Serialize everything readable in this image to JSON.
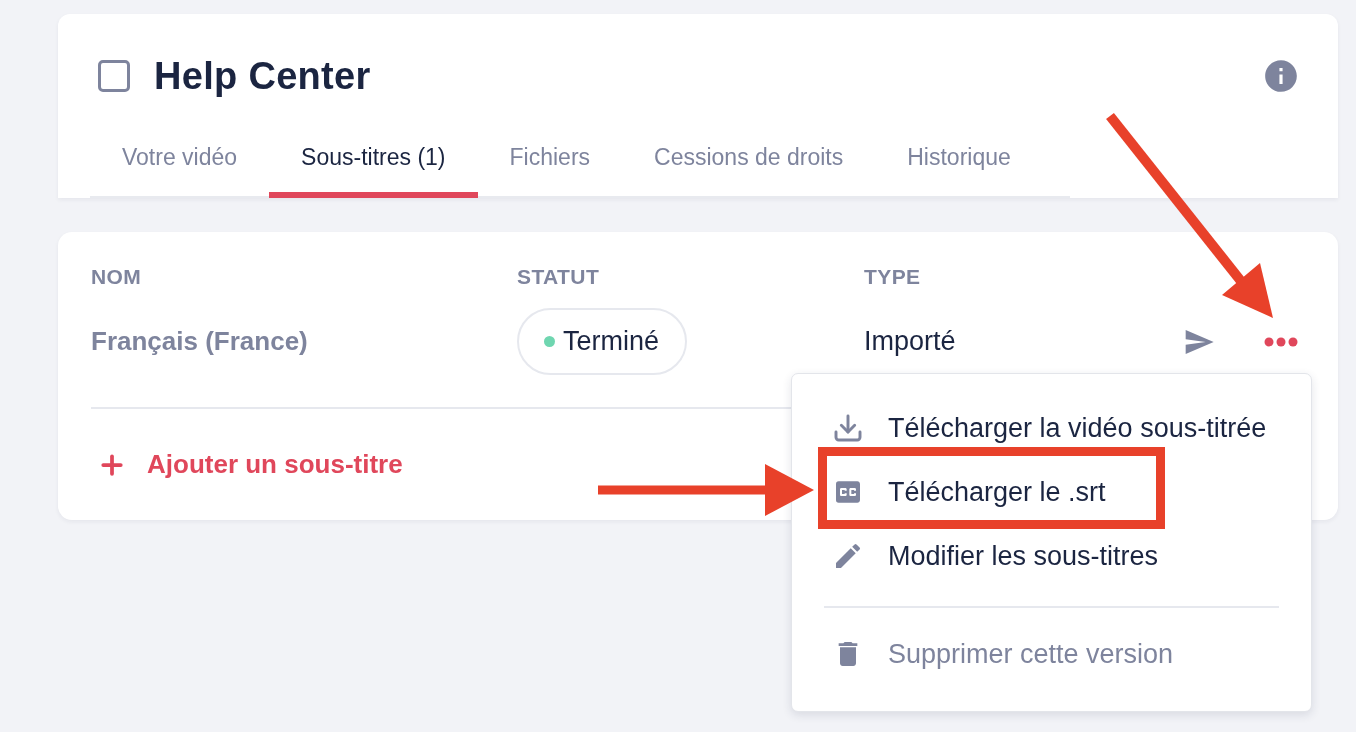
{
  "header": {
    "title": "Help Center",
    "checked": false
  },
  "tabs": [
    {
      "label": "Votre vidéo",
      "selected": false
    },
    {
      "label": "Sous-titres (1)",
      "selected": true
    },
    {
      "label": "Fichiers",
      "selected": false
    },
    {
      "label": "Cessions de droits",
      "selected": false
    },
    {
      "label": "Historique",
      "selected": false
    }
  ],
  "subtitles_table": {
    "columns": [
      "NOM",
      "STATUT",
      "TYPE"
    ],
    "rows": [
      {
        "name": "Français (France)",
        "status": {
          "label": "Terminé",
          "color": "#6fd6b0"
        },
        "type": "Importé"
      }
    ]
  },
  "add_button": {
    "label": "Ajouter un sous-titre"
  },
  "row_menu": {
    "groups": [
      {
        "items": [
          {
            "kind": "download",
            "label": "Télécharger la vidéo sous-titrée",
            "disabled": false,
            "highlighted": false
          },
          {
            "kind": "captions",
            "label": "Télécharger le .srt",
            "disabled": false,
            "highlighted": true
          },
          {
            "kind": "edit",
            "label": "Modifier les sous-titres",
            "disabled": false,
            "highlighted": false
          }
        ]
      },
      {
        "items": [
          {
            "kind": "delete",
            "label": "Supprimer cette version",
            "disabled": true,
            "highlighted": false
          }
        ]
      }
    ]
  }
}
